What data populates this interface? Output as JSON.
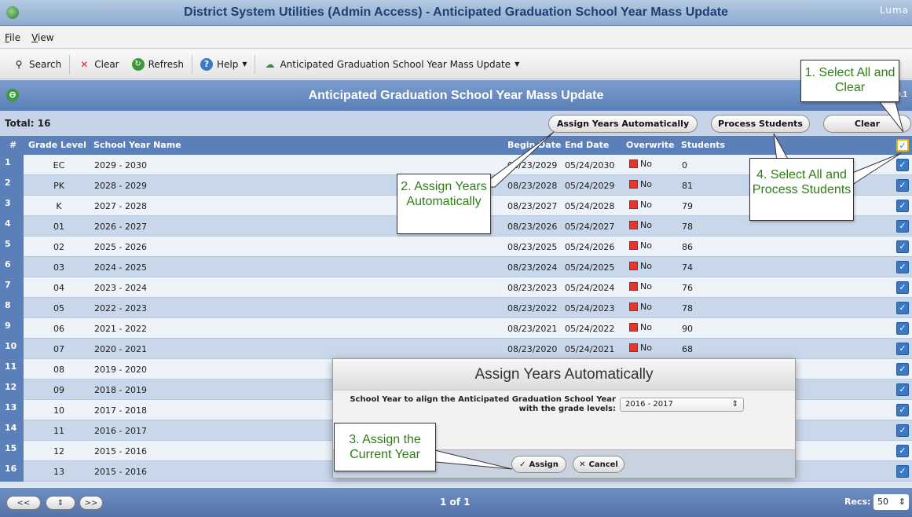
{
  "window": {
    "title": "District System Utilities (Admin Access) - Anticipated Graduation School Year Mass Update",
    "logo": "Luma"
  },
  "menu": [
    "File",
    "View"
  ],
  "toolbar": {
    "search": "Search",
    "clear": "Clear",
    "refresh": "Refresh",
    "help": "Help",
    "page_menu": "Anticipated Graduation School Year Mass Update"
  },
  "header": {
    "title": "Anticipated Graduation School Year Mass Update",
    "version": "0.1"
  },
  "actions": {
    "total": "Total: 16",
    "assign_years": "Assign Years Automatically",
    "process_students": "Process Students",
    "clear": "Clear"
  },
  "columns": {
    "num": "#",
    "grade_level": "Grade Level",
    "school_year_name": "School Year Name",
    "begin_date": "Begin Date",
    "end_date": "End Date",
    "overwrite": "Overwrite",
    "students": "Students"
  },
  "rows": [
    {
      "num": "1",
      "grade": "EC",
      "year": "2029 - 2030",
      "begin": "08/23/2029",
      "end": "05/24/2030",
      "overwrite": "No",
      "students": "0"
    },
    {
      "num": "2",
      "grade": "PK",
      "year": "2028 - 2029",
      "begin": "08/23/2028",
      "end": "05/24/2029",
      "overwrite": "No",
      "students": "81"
    },
    {
      "num": "3",
      "grade": "K",
      "year": "2027 - 2028",
      "begin": "08/23/2027",
      "end": "05/24/2028",
      "overwrite": "No",
      "students": "79"
    },
    {
      "num": "4",
      "grade": "01",
      "year": "2026 - 2027",
      "begin": "08/23/2026",
      "end": "05/24/2027",
      "overwrite": "No",
      "students": "78"
    },
    {
      "num": "5",
      "grade": "02",
      "year": "2025 - 2026",
      "begin": "08/23/2025",
      "end": "05/24/2026",
      "overwrite": "No",
      "students": "86"
    },
    {
      "num": "6",
      "grade": "03",
      "year": "2024 - 2025",
      "begin": "08/23/2024",
      "end": "05/24/2025",
      "overwrite": "No",
      "students": "74"
    },
    {
      "num": "7",
      "grade": "04",
      "year": "2023 - 2024",
      "begin": "08/23/2023",
      "end": "05/24/2024",
      "overwrite": "No",
      "students": "76"
    },
    {
      "num": "8",
      "grade": "05",
      "year": "2022 - 2023",
      "begin": "08/23/2022",
      "end": "05/24/2023",
      "overwrite": "No",
      "students": "78"
    },
    {
      "num": "9",
      "grade": "06",
      "year": "2021 - 2022",
      "begin": "08/23/2021",
      "end": "05/24/2022",
      "overwrite": "No",
      "students": "90"
    },
    {
      "num": "10",
      "grade": "07",
      "year": "2020 - 2021",
      "begin": "08/23/2020",
      "end": "05/24/2021",
      "overwrite": "No",
      "students": "68"
    },
    {
      "num": "11",
      "grade": "08",
      "year": "2019 - 2020",
      "begin": "",
      "end": "",
      "overwrite": "",
      "students": ""
    },
    {
      "num": "12",
      "grade": "09",
      "year": "2018 - 2019",
      "begin": "",
      "end": "",
      "overwrite": "",
      "students": ""
    },
    {
      "num": "13",
      "grade": "10",
      "year": "2017 - 2018",
      "begin": "",
      "end": "",
      "overwrite": "",
      "students": ""
    },
    {
      "num": "14",
      "grade": "11",
      "year": "2016 - 2017",
      "begin": "",
      "end": "",
      "overwrite": "",
      "students": ""
    },
    {
      "num": "15",
      "grade": "12",
      "year": "2015 - 2016",
      "begin": "",
      "end": "",
      "overwrite": "",
      "students": ""
    },
    {
      "num": "16",
      "grade": "13",
      "year": "2015 - 2016",
      "begin": "",
      "end": "",
      "overwrite": "",
      "students": ""
    }
  ],
  "footer": {
    "first": "<<",
    "last": ">>",
    "pager": "1 of 1",
    "recs_label": "Recs:",
    "recs_value": "50"
  },
  "dialog": {
    "title": "Assign Years Automatically",
    "label": "School Year to align the Anticipated Graduation School Year with the grade levels:",
    "select_value": "2016 - 2017",
    "assign": "Assign",
    "cancel": "Cancel"
  },
  "callouts": {
    "c1": "1. Select All and Clear",
    "c2": "2. Assign Years Automatically",
    "c3": "3. Assign the Current Year",
    "c4": "4. Select All and Process Students"
  },
  "colors": {
    "header_blue": "#5b7fb8",
    "row_light": "#eef3fa",
    "row_dark": "#c9d7ea",
    "overwrite_red": "#e8362a",
    "callout_green": "#2e7d17"
  }
}
